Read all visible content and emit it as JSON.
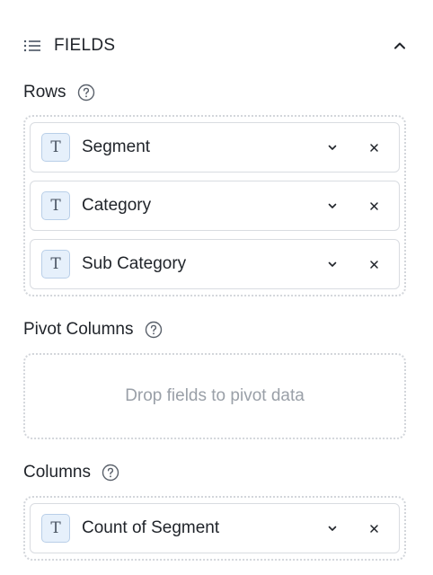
{
  "panel": {
    "title": "FIELDS",
    "icons": {
      "menu": "list-icon",
      "collapse": "chevron-up-icon"
    }
  },
  "rows": {
    "label": "Rows",
    "fields": [
      {
        "label": "Segment",
        "type_icon": "T"
      },
      {
        "label": "Category",
        "type_icon": "T"
      },
      {
        "label": "Sub Category",
        "type_icon": "T"
      }
    ]
  },
  "pivot_columns": {
    "label": "Pivot Columns",
    "placeholder": "Drop fields to pivot data"
  },
  "columns": {
    "label": "Columns",
    "fields": [
      {
        "label": "Count of Segment",
        "type_icon": "T"
      }
    ]
  },
  "colors": {
    "badge_bg": "#e6f0fb",
    "badge_border": "#b9cfe8",
    "zone_border": "#d3d6db",
    "placeholder_text": "#9aa0a8"
  }
}
